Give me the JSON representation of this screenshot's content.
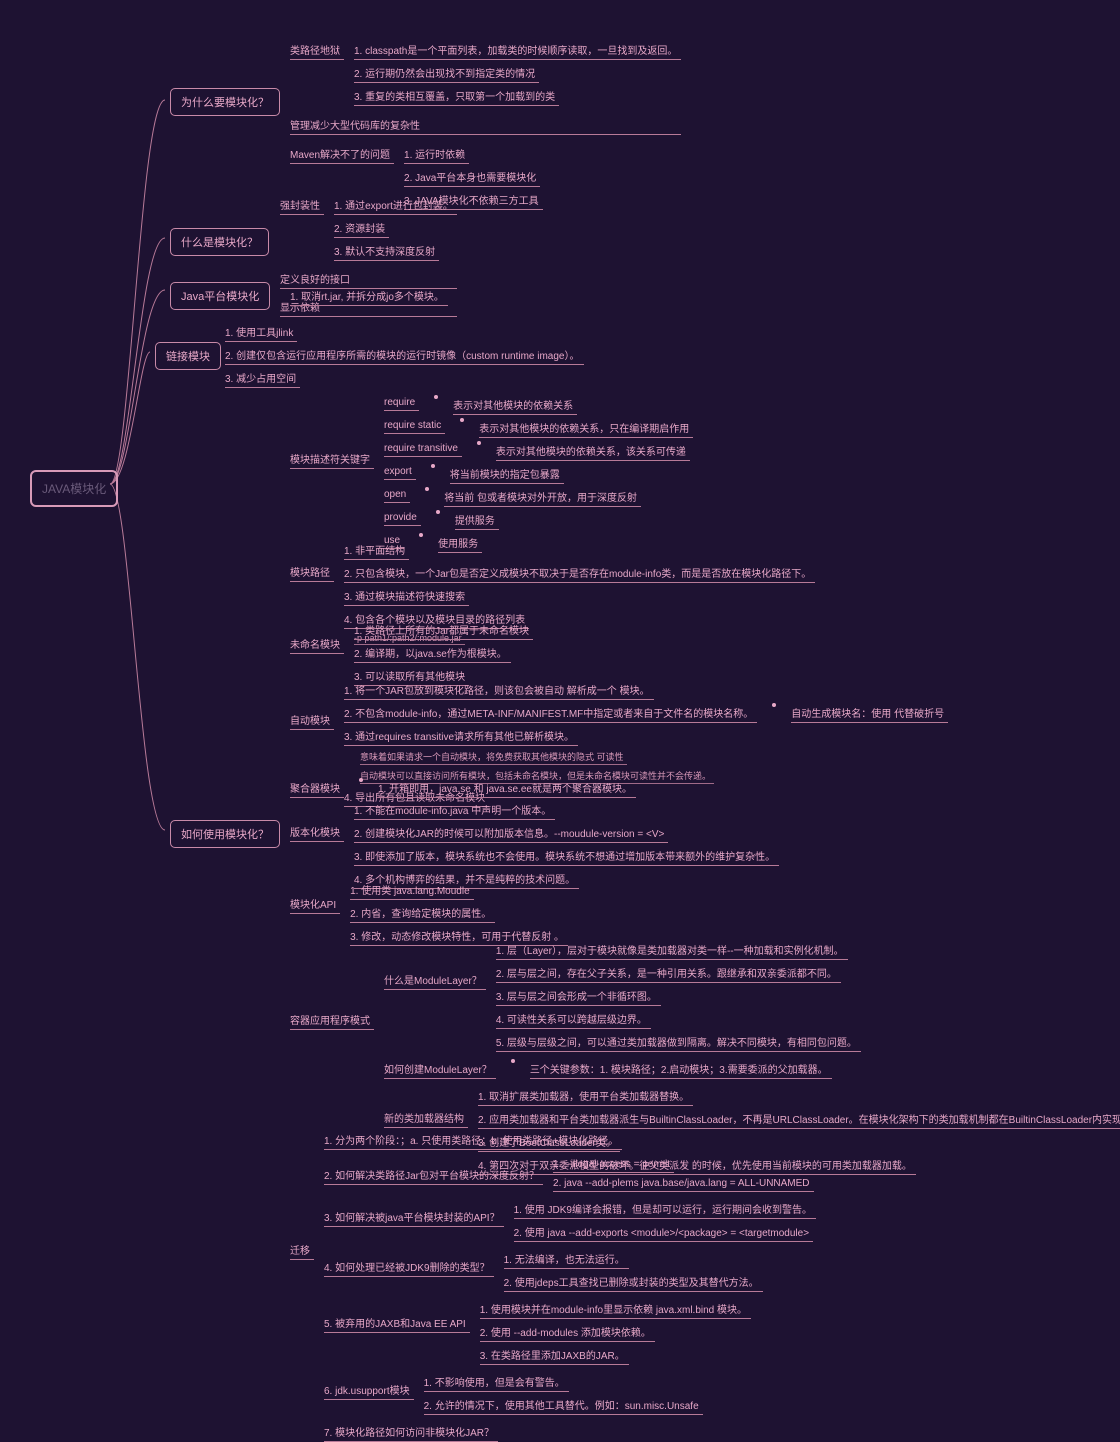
{
  "root": "JAVA模块化",
  "b1": {
    "title": "为什么要模块化？",
    "sub1_title": "类路径地狱",
    "sub1": [
      "1. classpath是一个平面列表，加载类的时候顺序读取，一旦找到及返回。",
      "2. 运行期仍然会出现找不到指定类的情况",
      "3. 重复的类相互覆盖，只取第一个加载到的类"
    ],
    "sub2": "管理减少大型代码库的复杂性",
    "sub3_title": "Maven解决不了的问题",
    "sub3": [
      "1. 运行时依赖",
      "2. Java平台本身也需要模块化",
      "3. JAVA模块化不依赖三方工具"
    ]
  },
  "b2": {
    "title": "什么是模块化？",
    "sub1_title": "强封装性",
    "sub1": [
      "1. 通过export进行包封装。",
      "2. 资源封装",
      "3. 默认不支持深度反射"
    ],
    "sub2": "定义良好的接口",
    "sub3": "显示依赖"
  },
  "b3": {
    "title": "Java平台模块化",
    "sub": "1. 取消rt.jar, 并拆分成jo多个模块。"
  },
  "b4": {
    "title": "链接模块",
    "subs": [
      "1. 使用工具jlink",
      "2. 创建仅包含运行应用程序所需的模块的运行时镜像（custom runtime image）。",
      "3. 减少占用空间"
    ]
  },
  "b5": {
    "title": "如何使用模块化？",
    "kw_title": "模块描述符关键字",
    "kw": [
      {
        "k": "require",
        "d": "表示对其他模块的依赖关系"
      },
      {
        "k": "require static",
        "d": "表示对其他模块的依赖关系，只在编译期启作用"
      },
      {
        "k": "require transitive",
        "d": "表示对其他模块的依赖关系，该关系可传递"
      },
      {
        "k": "export",
        "d": "将当前模块的指定包暴露"
      },
      {
        "k": "open",
        "d": "将当前 包或者模块对外开放，用于深度反射"
      },
      {
        "k": "provide",
        "d": "提供服务"
      },
      {
        "k": "use",
        "d": "使用服务"
      }
    ],
    "path_title": "模块路径",
    "path": [
      "1. 非平面结构",
      "2. 只包含模块，一个Jar包是否定义成模块不取决于是否存在module-info类，而是是否放在模块化路径下。",
      "3. 通过模块描述符快速搜索",
      "4. 包含各个模块以及模块目录的路径列表"
    ],
    "path_extra": "-p  path1/:path2/:module.jar",
    "unnamed_title": "未命名模块",
    "unnamed": [
      "1. 类路径上所有的Jar都属于未命名模块",
      "2. 编译期，以java.se作为根模块。",
      "3. 可以读取所有其他模块"
    ],
    "auto_title": "自动模块",
    "auto": [
      "1. 将一个JAR包放到模块化路径，则该包会被自动 解析成一个 模块。",
      "2. 不包含module-info，通过META-INF/MANIFEST.MF中指定或者来自于文件名的模块名称。",
      "3. 通过requires transitive请求所有其他已解析模块。",
      "4. 导出所有包且读取未命名模块"
    ],
    "auto_extra": "自动生成模块名：使用 代替破折号",
    "auto_sub3": [
      "意味着如果请求一个自动模块，将免费获取其他模块的隐式 可读性",
      "自动模块可以直接访问所有模块，包括未命名模块，但是未命名模块可读性并不会传递。"
    ],
    "agg_title": "聚合器模块",
    "agg": "1. 开箱即用，java.se  和 java.se.ee就是两个聚合器模块。",
    "ver_title": "版本化模块",
    "ver": [
      "1. 不能在module-info.java 中声明一个版本。",
      "2. 创建模块化JAR的时候可以附加版本信息。--moudule-version = <V>",
      "3. 即使添加了版本，模块系统也不会使用。模块系统不想通过增加版本带来额外的维护复杂性。",
      "4. 多个机构博弈的结果，并不是纯粹的技术问题。"
    ],
    "api_title": "模块化API",
    "api": [
      "1. 使用类 java.lang.Moudle",
      "2. 内省，查询给定模块的属性。",
      "3. 修改，动态修改模块特性，可用于代替反射 。"
    ],
    "container_title": "容器应用程序模式",
    "ml_title": "什么是ModuleLayer？",
    "ml": [
      "1. 层（Layer），层对于模块就像是类加载器对类一样--一种加载和实例化机制。",
      "2. 层与层之间，存在父子关系，是一种引用关系。跟继承和双亲委派都不同。",
      "3. 层与层之间会形成一个非循环图。",
      "4. 可读性关系可以跨越层级边界。",
      "5. 层级与层级之间，可以通过类加载器做到隔离。解决不同模块，有相同包问题。"
    ],
    "ml_create_title": "如何创建ModuleLayer？",
    "ml_create": "三个关键参数：1. 模块路径；2.启动模块；3.需要委派的父加载器。",
    "loader_title": "新的类加载器结构",
    "loader": [
      "1. 取消扩展类加载器，使用平台类加载器替换。",
      "2. 应用类加载器和平台类加载器派生与BuiltinClassLoader，不再是URLClassLoader。在模块化架构下的类加载机制都在BuiltinClassLoader内实现。",
      "3. 创建了BootClassLoader类。",
      "4. 第四次对于双亲委派模型的破坏。往父类派发 的时候，优先使用当前模块的可用类加载器加载。"
    ],
    "mig_title": "迁移",
    "mig1": "1. 分为两个阶段：；a. 只使用类路径；b. 使用类路径+模块化路径。",
    "mig2_title": "2. 如何解决类路径Jar包对平台模块的深度反射？",
    "mig2": [
      "1. --illegal-access = permit",
      "2. java --add-plems java.base/java.lang  = ALL-UNNAMED"
    ],
    "mig3_title": "3. 如何解决被java平台模块封装的API？",
    "mig3": [
      "1. 使用 JDK9编译会报错，但是却可以运行，运行期间会收到警告。",
      "2. 使用 java --add-exports <module>/<package> =  <targetmodule>"
    ],
    "mig4_title": "4. 如何处理已经被JDK9删除的类型？",
    "mig4": [
      "1. 无法编译，也无法运行。",
      "2. 使用jdeps工具查找已删除或封装的类型及其替代方法。"
    ],
    "mig5_title": "5. 被弃用的JAXB和Java EE API",
    "mig5": [
      "1. 使用模块并在module-info里显示依赖 java.xml.bind  模块。",
      "2. 使用 --add-modules  添加模块依赖。",
      "3. 在类路径里添加JAXB的JAR。"
    ],
    "mig6_title": "6.  jdk.usupport模块",
    "mig6": [
      "1. 不影响使用，但是会有警告。",
      "2. 允许的情况下，使用其他工具替代。例如：sun.misc.Unsafe"
    ],
    "mig7": "7. 模块化路径如何访问非模块化JAR？"
  }
}
